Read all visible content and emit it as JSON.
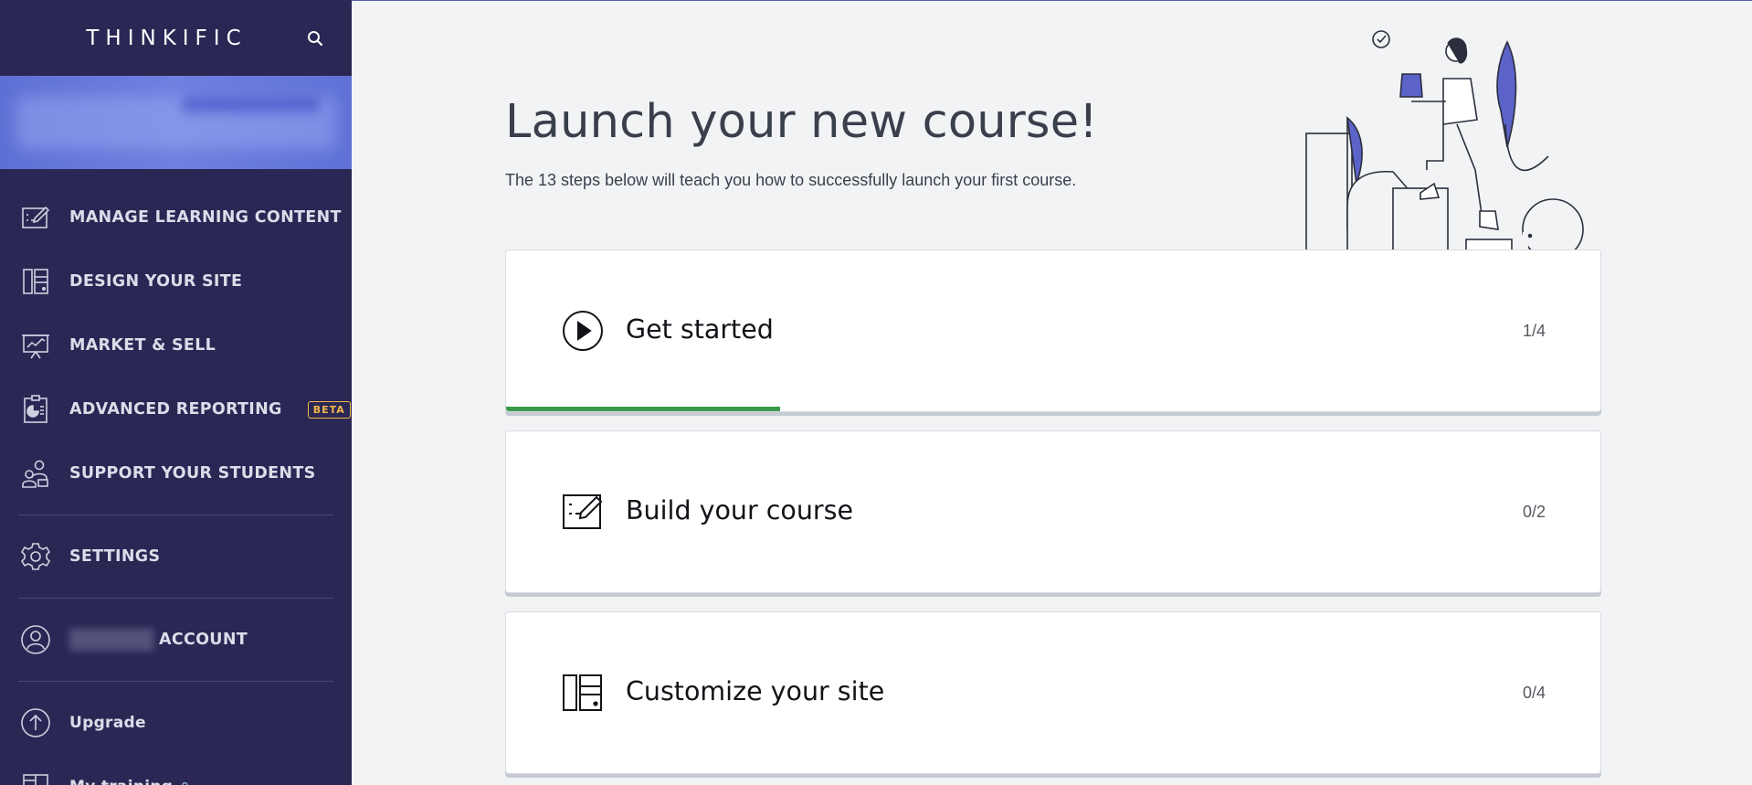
{
  "brand": {
    "logo_text": "THINKIFIC"
  },
  "sidebar": {
    "items": [
      {
        "label": "MANAGE LEARNING CONTENT",
        "icon": "edit-content-icon"
      },
      {
        "label": "DESIGN YOUR SITE",
        "icon": "layout-icon"
      },
      {
        "label": "MARKET & SELL",
        "icon": "chart-board-icon"
      },
      {
        "label": "ADVANCED REPORTING",
        "icon": "report-icon",
        "badge": "BETA"
      },
      {
        "label": "SUPPORT YOUR STUDENTS",
        "icon": "students-icon"
      },
      {
        "label": "SETTINGS",
        "icon": "gear-icon"
      },
      {
        "label": "ACCOUNT",
        "icon": "user-circle-icon"
      },
      {
        "label": "Upgrade",
        "icon": "upgrade-arrow-icon"
      },
      {
        "label": "My training",
        "icon": "book-icon"
      }
    ]
  },
  "main": {
    "title": "Launch your new course!",
    "subtitle": "The 13 steps below will teach you how to successfully launch your first course.",
    "steps": [
      {
        "title": "Get started",
        "count": "1/4",
        "icon": "play-circle-icon",
        "progress": 0.25
      },
      {
        "title": "Build your course",
        "count": "0/2",
        "icon": "edit-content-icon",
        "progress": 0
      },
      {
        "title": "Customize your site",
        "count": "0/4",
        "icon": "layout-icon",
        "progress": 0
      }
    ]
  },
  "colors": {
    "sidebar_bg": "#2b2754",
    "accent_banner": "#5e70d4",
    "badge": "#f2b84b",
    "progress": "#3a9a4a",
    "main_bg": "#f2f3f5"
  }
}
